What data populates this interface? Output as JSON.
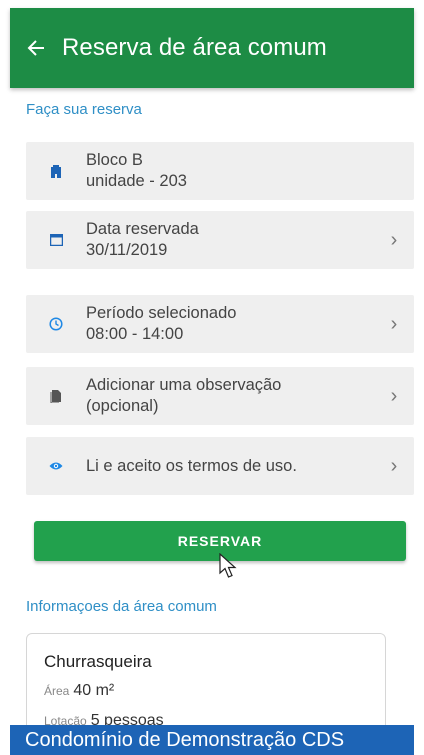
{
  "header": {
    "back_icon": "arrow-left-icon",
    "title": "Reserva de área comum",
    "color": "#1d8c45"
  },
  "reservation": {
    "section_title": "Faça sua reserva",
    "unit": {
      "icon": "building-icon",
      "line1": "Bloco B",
      "line2": "unidade - 203"
    },
    "date": {
      "icon": "calendar-icon",
      "line1": "Data reservada",
      "line2": "30/11/2019"
    },
    "period": {
      "icon": "clock-icon",
      "line1": "Período selecionado",
      "line2": "08:00 - 14:00"
    },
    "note": {
      "icon": "document-icon",
      "line1": "Adicionar uma observação",
      "line2": "(opcional)"
    },
    "terms": {
      "icon": "eye-icon",
      "line1": "Li e aceito os termos de uso."
    },
    "chevron": "›",
    "button_label": "RESERVAR",
    "button_color": "#22a14d"
  },
  "info": {
    "section_title": "Informaçoes da área comum",
    "name": "Churrasqueira",
    "area_label": "Área",
    "area_value": "40 m²",
    "capacity_label": "Lotação",
    "capacity_value": "5 pessoas"
  },
  "footer": {
    "text": "Condomínio de Demonstração CDS",
    "color": "#1d64b6"
  }
}
